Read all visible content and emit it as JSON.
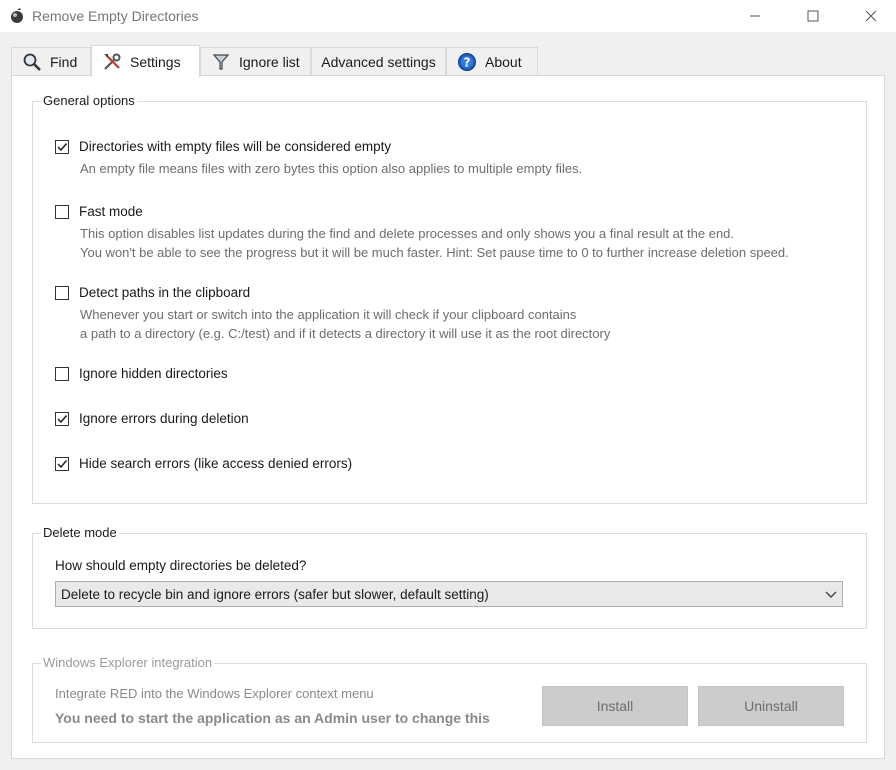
{
  "window": {
    "title": "Remove Empty Directories",
    "minimize_icon": "minimize-icon",
    "maximize_icon": "maximize-icon",
    "close_icon": "close-icon"
  },
  "tabs": [
    {
      "label": "Find",
      "icon": "magnifier-icon"
    },
    {
      "label": "Settings",
      "icon": "tools-icon",
      "active": true
    },
    {
      "label": "Ignore list",
      "icon": "filter-icon"
    },
    {
      "label": "Advanced settings"
    },
    {
      "label": "About",
      "icon": "help-icon"
    }
  ],
  "general": {
    "title": "General options",
    "options": [
      {
        "label": "Directories with empty files will be considered empty",
        "checked": true,
        "desc": [
          "An empty file means files with zero bytes this option also applies to multiple empty files."
        ]
      },
      {
        "label": "Fast mode",
        "checked": false,
        "desc": [
          "This option disables list updates during the find and delete processes and only shows you a final result at the end.",
          "You won't be able to see the progress but it will be much faster. Hint: Set pause time to 0 to further increase deletion speed."
        ]
      },
      {
        "label": "Detect paths in the clipboard",
        "checked": false,
        "desc": [
          "Whenever you start or switch into the application it will check if your clipboard contains",
          "a path to a directory (e.g. C:/test) and if it detects a directory it will use it as the root directory"
        ]
      },
      {
        "label": "Ignore hidden directories",
        "checked": false
      },
      {
        "label": "Ignore errors during deletion",
        "checked": true
      },
      {
        "label": "Hide search errors (like access denied errors)",
        "checked": true
      }
    ]
  },
  "delete_mode": {
    "title": "Delete mode",
    "question": "How should empty directories be deleted?",
    "selected": "Delete to recycle bin and ignore errors (safer but slower, default setting)"
  },
  "explorer": {
    "title": "Windows Explorer integration",
    "text1": "Integrate RED into the Windows Explorer context menu",
    "text2": "You need to start the application as an Admin user to change this",
    "install_label": "Install",
    "uninstall_label": "Uninstall"
  }
}
